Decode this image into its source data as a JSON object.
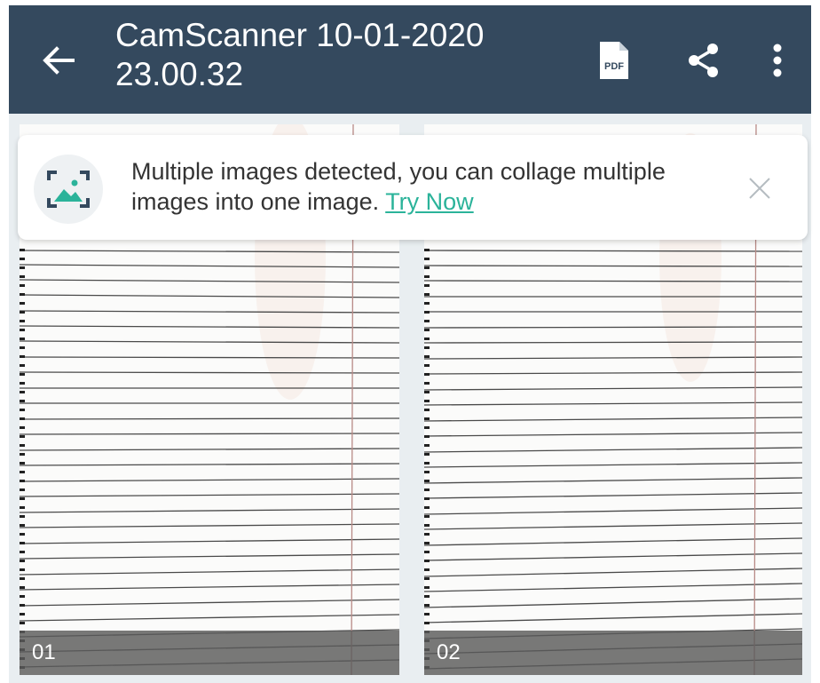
{
  "appbar": {
    "title": "CamScanner 10-01-2020 23.00.32",
    "back_icon": "arrow-left-icon",
    "pdf_icon": "pdf-file-icon",
    "pdf_icon_text": "PDF",
    "share_icon": "share-icon",
    "more_icon": "more-vertical-icon",
    "background_color": "#34495e"
  },
  "banner": {
    "icon": "collage-image-icon",
    "message": "Multiple images detected, you can collage multiple images into one image.",
    "link_label": "Try Now",
    "link_color": "#2bb39a",
    "close_icon": "close-icon"
  },
  "pages": [
    {
      "label": "01"
    },
    {
      "label": "02"
    }
  ]
}
